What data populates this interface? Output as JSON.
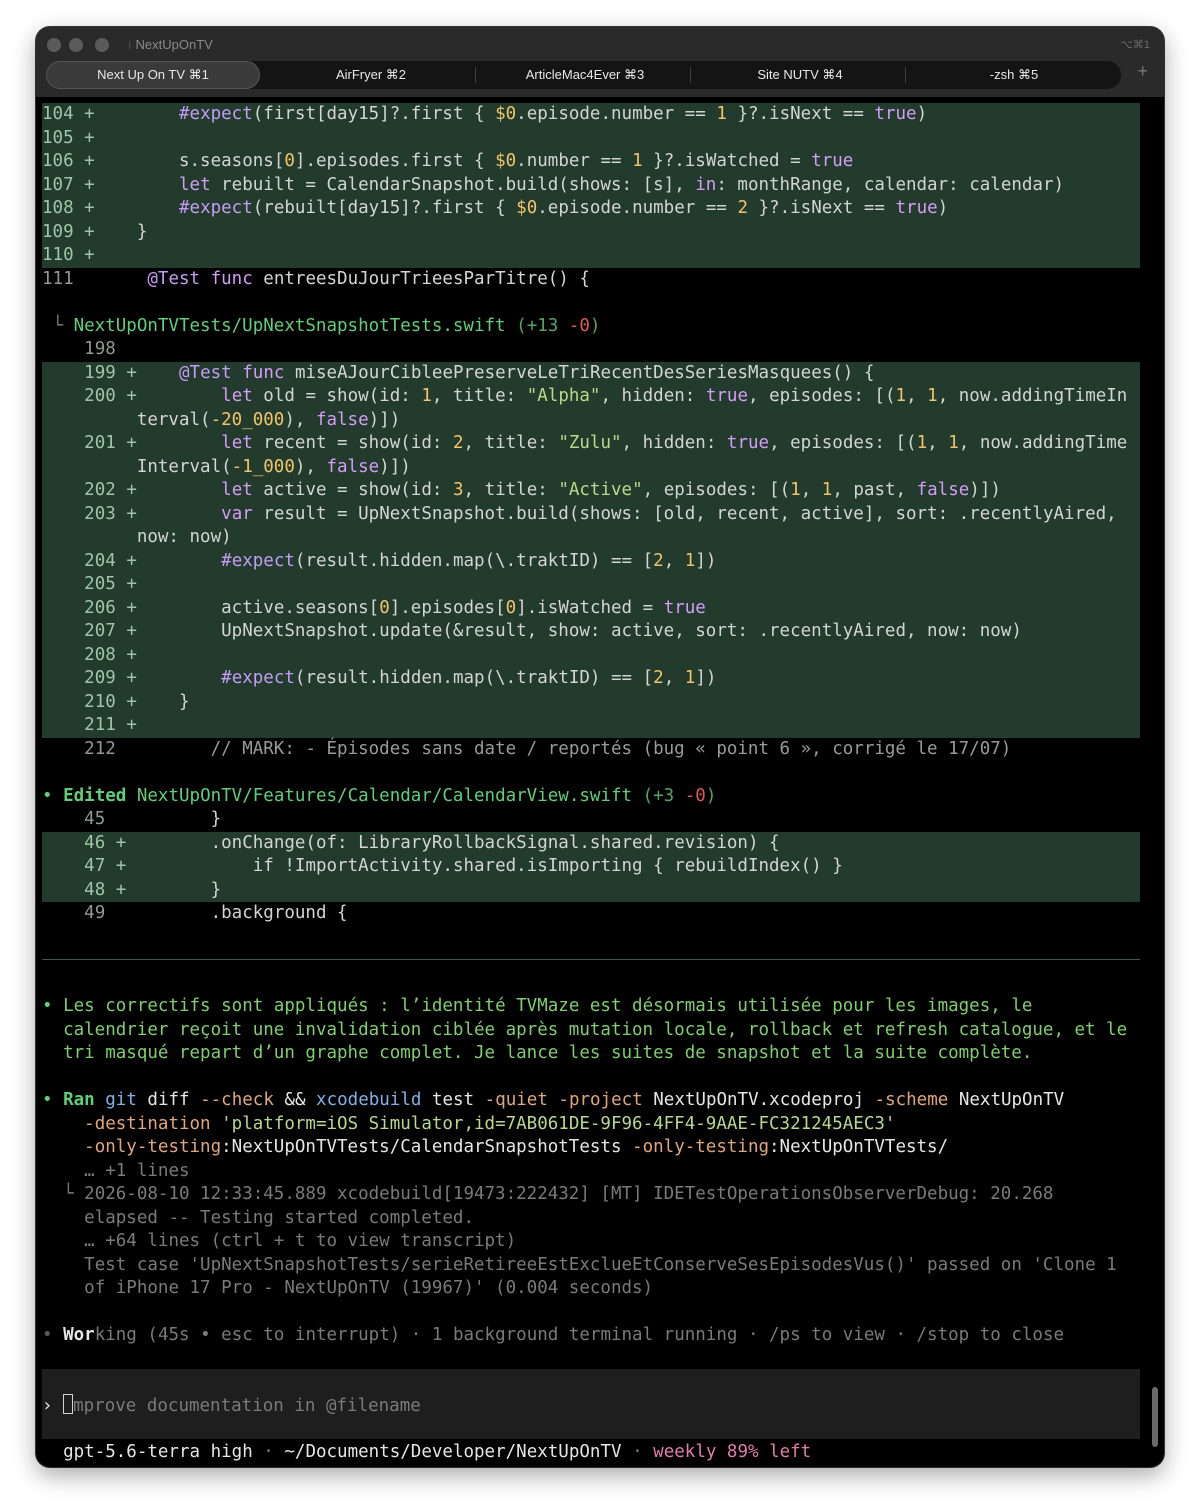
{
  "window": {
    "title": "NextUpOnTV",
    "shortcut": "⌥⌘1",
    "tabs": [
      {
        "label": "Next Up On TV ⌘1",
        "active": true
      },
      {
        "label": "AirFryer ⌘2"
      },
      {
        "label": "ArticleMac4Ever ⌘3"
      },
      {
        "label": "Site NUTV ⌘4"
      },
      {
        "label": "-zsh ⌘5"
      }
    ],
    "new_tab": "+"
  },
  "diff1": {
    "lines": [
      {
        "n": "104",
        "code": "        #expect(first[day15]?.first { $0.episode.number == 1 }?.isNext == true)"
      },
      {
        "n": "105",
        "code": ""
      },
      {
        "n": "106",
        "code": "        s.seasons[0].episodes.first { $0.number == 1 }?.isWatched = true"
      },
      {
        "n": "107",
        "code": "        let rebuilt = CalendarSnapshot.build(shows: [s], in: monthRange, calendar: calendar)"
      },
      {
        "n": "108",
        "code": "        #expect(rebuilt[day15]?.first { $0.episode.number == 2 }?.isNext == true)"
      },
      {
        "n": "109",
        "code": "    }"
      },
      {
        "n": "110",
        "code": ""
      }
    ],
    "context_line": {
      "n": "111",
      "code": "    @Test func entreesDuJourTrieesParTitre() {"
    }
  },
  "file2": {
    "path": "NextUpOnTVTests/UpNextSnapshotTests.swift",
    "added": "+13",
    "removed": "-0",
    "context_first": {
      "n": "198"
    },
    "last_context": {
      "n": "212",
      "code": "    // MARK: - Épisodes sans date / reportés (bug « point 6 », corrigé le 17/07)"
    }
  },
  "file3": {
    "verb": "Edited",
    "path": "NextUpOnTV/Features/Calendar/CalendarView.swift",
    "added": "+3",
    "removed": "-0",
    "lines": [
      {
        "n": "45",
        "code": "        }",
        "add": false
      },
      {
        "n": "46",
        "code": "        .onChange(of: LibraryRollbackSignal.shared.revision) {",
        "add": true
      },
      {
        "n": "47",
        "code": "            if !ImportActivity.shared.isImporting { rebuildIndex() }",
        "add": true
      },
      {
        "n": "48",
        "code": "        }",
        "add": true
      },
      {
        "n": "49",
        "code": "        .background {",
        "add": false
      }
    ]
  },
  "message": {
    "line1": "Les correctifs sont appliqués : l’identité TVMaze est désormais utilisée pour les images, le",
    "line2": "calendrier reçoit une invalidation ciblée après mutation locale, rollback et refresh catalogue, et le",
    "line3": "tri masqué repart d’un graphe complet. Je lance les suites de snapshot et la suite complète."
  },
  "ran": {
    "verb": "Ran",
    "more_lines": "… +1 lines",
    "log1": "2026-08-10 12:33:45.889 xcodebuild[19473:222432] [MT] IDETestOperationsObserverDebug: 20.268",
    "log2": "elapsed -- Testing started completed.",
    "more_lines2": "… +64 lines (ctrl + t to view transcript)",
    "test1": "Test case 'UpNextSnapshotTests/serieRetireeEstExclueEtConserveSesEpisodesVus()' passed on 'Clone 1",
    "test2": "of iPhone 17 Pro - NextUpOnTV (19967)' (0.004 seconds)"
  },
  "status": {
    "working_a": "Wor",
    "working_b": "king",
    "rest": "(45s • esc to interrupt) · 1 background terminal running · /ps to view · /stop to close"
  },
  "prompt": {
    "chevron": "›",
    "placeholder": "mprove documentation in @filename"
  },
  "footer": {
    "model": "gpt-5.6-terra high",
    "path": "~/Documents/Developer/NextUpOnTV",
    "quota": "weekly 89% left",
    "sep": "·"
  }
}
